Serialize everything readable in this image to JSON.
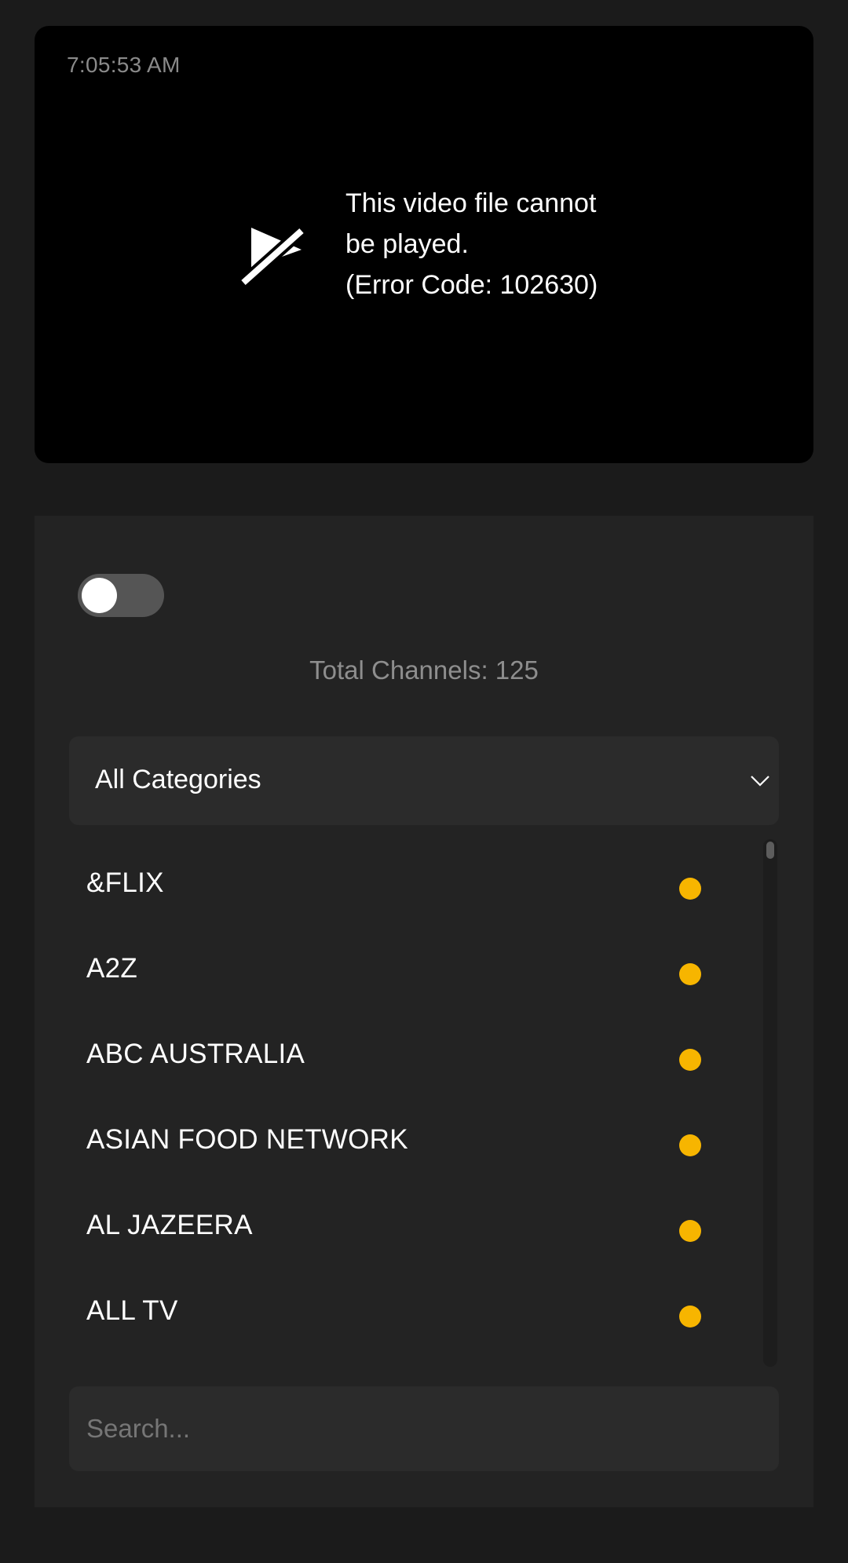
{
  "player": {
    "clock": "7:05:53 AM",
    "error_icon": "video-off-icon",
    "error_lines": [
      "This video file cannot",
      "be played.",
      "(Error Code: 102630)"
    ]
  },
  "toggle": {
    "state": "off"
  },
  "total_channels": "Total Channels: 125",
  "category_select": {
    "selected": "All Categories",
    "icon": "chevron-down-icon"
  },
  "channels": [
    {
      "name": "&FLIX"
    },
    {
      "name": "A2Z"
    },
    {
      "name": "ABC AUSTRALIA"
    },
    {
      "name": "ASIAN FOOD NETWORK"
    },
    {
      "name": "AL JAZEERA"
    },
    {
      "name": "ALL TV"
    }
  ],
  "status_color": "#f7b500",
  "search": {
    "placeholder": "Search..."
  }
}
